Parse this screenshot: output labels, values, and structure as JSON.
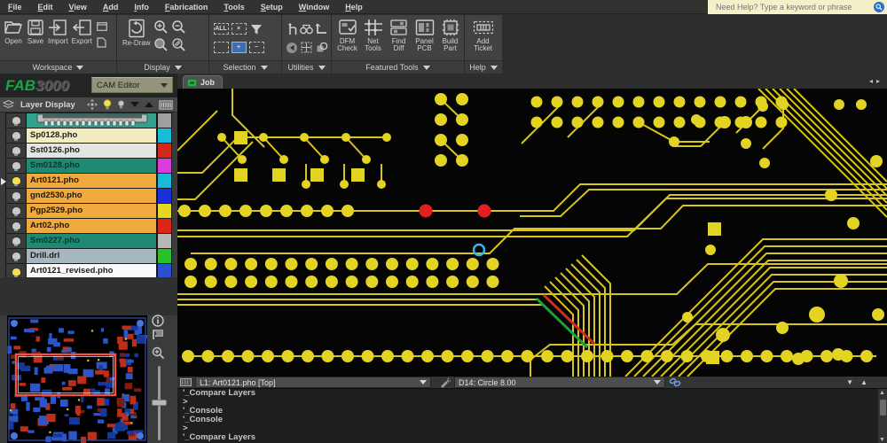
{
  "menu": {
    "items": [
      "File",
      "Edit",
      "View",
      "Add",
      "Info",
      "Fabrication",
      "Tools",
      "Setup",
      "Window",
      "Help"
    ]
  },
  "help_search": {
    "placeholder": "Need Help? Type a keyword or phrase"
  },
  "toolbar": {
    "workspace": {
      "label": "Workspace",
      "open": "Open",
      "save": "Save",
      "import": "Import",
      "export": "Export"
    },
    "display": {
      "label": "Display",
      "redraw": "Re-Draw"
    },
    "selection": {
      "label": "Selection",
      "select_all": "ALL",
      "deselect": "×",
      "add_select": "+",
      "remove_select": "−"
    },
    "utilities": {
      "label": "Utilities"
    },
    "featured": {
      "label": "Featured Tools",
      "dfm_check": "DFM Check",
      "net_tools": "Net Tools",
      "find_diff": "Find Diff",
      "panel_pcb": "Panel PCB",
      "build_part": "Build Part"
    },
    "help_group": {
      "label": "Help",
      "add_ticket": "Add Ticket"
    }
  },
  "branding": {
    "logo_fab": "FAB",
    "logo_3000": "3000",
    "mode": "CAM Editor"
  },
  "layer_panel": {
    "title": "Layer Display",
    "items": [
      {
        "name": "",
        "bg": "#2fa18c",
        "fg": "#0d332a",
        "swatch": "#9f9f9d",
        "bulb": "#c9c9c9"
      },
      {
        "name": "Sp0128.pho",
        "bg": "#f2ecc0",
        "fg": "#20201a",
        "swatch": "#17bcd9",
        "bulb": "#c9c9c9"
      },
      {
        "name": "Sst0126.pho",
        "bg": "#e4e4e2",
        "fg": "#20201a",
        "swatch": "#d2281c",
        "bulb": "#c9c9c9"
      },
      {
        "name": "Sm0128.pho",
        "bg": "#1e8a74",
        "fg": "#0d332a",
        "swatch": "#dd3cdd",
        "bulb": "#c9c9c9"
      },
      {
        "name": "Art0121.pho",
        "bg": "#efa93c",
        "fg": "#20160a",
        "swatch": "#17bcd9",
        "bulb": "#f2df55"
      },
      {
        "name": "gnd2530.pho",
        "bg": "#efa93c",
        "fg": "#20160a",
        "swatch": "#1b2fd8",
        "bulb": "#c9c9c9"
      },
      {
        "name": "Pgp2529.pho",
        "bg": "#efa93c",
        "fg": "#20160a",
        "swatch": "#e4d821",
        "bulb": "#c9c9c9"
      },
      {
        "name": "Art02.pho",
        "bg": "#efa93c",
        "fg": "#20160a",
        "swatch": "#de2414",
        "bulb": "#c9c9c9"
      },
      {
        "name": "Sm0227.pho",
        "bg": "#1e8a74",
        "fg": "#0d332a",
        "swatch": "#b8b9b5",
        "bulb": "#c9c9c9"
      },
      {
        "name": "Drill.drl",
        "bg": "#a7b7bf",
        "fg": "#1a1a1a",
        "swatch": "#28c228",
        "bulb": "#c9c9c9"
      },
      {
        "name": "Art0121_revised.pho",
        "bg": "#fafaf8",
        "fg": "#1a1a1a",
        "swatch": "#2b51d2",
        "bulb": "#f2df55"
      }
    ]
  },
  "job_tab": {
    "label": "Job"
  },
  "status_bar": {
    "layer_selector": "L1: Art0121.pho  [Top]",
    "dcode_selector": "D14: Circle 8.00"
  },
  "console": {
    "lines": [
      "'_Compare Layers",
      ">",
      "'_Console",
      "'_Console",
      ">",
      "'_Compare Layers"
    ]
  },
  "canvas": {
    "background": "#050505",
    "trace": "#d7c51f",
    "pad": "#e3d322",
    "error_pad": "#e31f1f",
    "highlight": "#35b5e5",
    "diff_green": "#1ca03e",
    "diff_red": "#cf2d1d",
    "thumb_blue": "#2b55c8",
    "thumb_blue2": "#16389b",
    "thumb_red": "#bf2f17",
    "thumb_red2": "#7c1c0e",
    "thumb_accent": "#d8c81e",
    "viewport_outline": "#f25242"
  }
}
